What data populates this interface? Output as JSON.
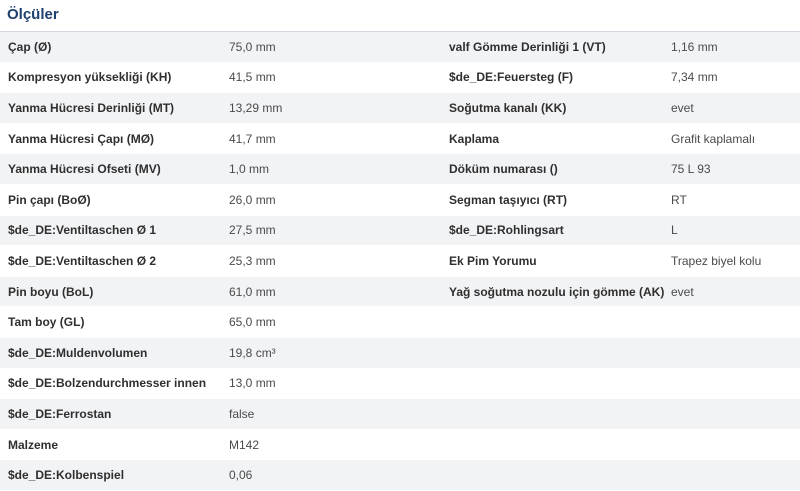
{
  "section": {
    "title": "Ölçüler"
  },
  "rows": [
    {
      "k1": "Çap (Ø)",
      "v1": "75,0 mm",
      "k2": "valf Gömme Derinliği 1 (VT)",
      "v2": "1,16 mm"
    },
    {
      "k1": "Kompresyon yüksekliği (KH)",
      "v1": "41,5 mm",
      "k2": "$de_DE:Feuersteg (F)",
      "v2": "7,34 mm"
    },
    {
      "k1": "Yanma Hücresi Derinliği (MT)",
      "v1": "13,29 mm",
      "k2": "Soğutma kanalı (KK)",
      "v2": "evet"
    },
    {
      "k1": "Yanma Hücresi Çapı (MØ)",
      "v1": "41,7 mm",
      "k2": "Kaplama",
      "v2": "Grafit kaplamalı"
    },
    {
      "k1": "Yanma Hücresi Ofseti (MV)",
      "v1": "1,0 mm",
      "k2": "Döküm numarası ()",
      "v2": "75 L 93"
    },
    {
      "k1": "Pin çapı (BoØ)",
      "v1": "26,0 mm",
      "k2": "Segman taşıyıcı (RT)",
      "v2": "RT"
    },
    {
      "k1": "$de_DE:Ventiltaschen Ø 1",
      "v1": "27,5 mm",
      "k2": "$de_DE:Rohlingsart",
      "v2": "L"
    },
    {
      "k1": "$de_DE:Ventiltaschen Ø 2",
      "v1": "25,3 mm",
      "k2": "Ek Pim Yorumu",
      "v2": "Trapez biyel kolu"
    },
    {
      "k1": "Pin boyu (BoL)",
      "v1": "61,0 mm",
      "k2": "Yağ soğutma nozulu için gömme (AK)",
      "v2": "evet"
    },
    {
      "k1": "Tam boy (GL)",
      "v1": "65,0 mm",
      "k2": "",
      "v2": ""
    },
    {
      "k1": "$de_DE:Muldenvolumen",
      "v1": "19,8 cm³",
      "k2": "",
      "v2": ""
    },
    {
      "k1": "$de_DE:Bolzendurchmesser innen",
      "v1": "13,0 mm",
      "k2": "",
      "v2": ""
    },
    {
      "k1": "$de_DE:Ferrostan",
      "v1": "false",
      "k2": "",
      "v2": ""
    },
    {
      "k1": "Malzeme",
      "v1": "M142",
      "k2": "",
      "v2": ""
    },
    {
      "k1": "$de_DE:Kolbenspiel",
      "v1": "0,06",
      "k2": "",
      "v2": ""
    }
  ]
}
